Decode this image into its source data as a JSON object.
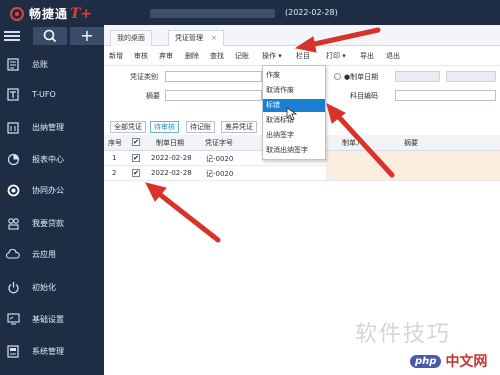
{
  "app": {
    "logo_text": "畅捷通",
    "logo_suffix": "T+",
    "date": "(2022-02-28)"
  },
  "sidebar": {
    "items": [
      {
        "label": "总账",
        "icon": "ledger-icon"
      },
      {
        "label": "T-UFO",
        "icon": "report-t-icon"
      },
      {
        "label": "出纳管理",
        "icon": "cashier-icon"
      },
      {
        "label": "报表中心",
        "icon": "pie-chart-icon"
      },
      {
        "label": "协同办公",
        "icon": "collab-icon"
      },
      {
        "label": "我要贷款",
        "icon": "loan-icon"
      },
      {
        "label": "云应用",
        "icon": "cloud-icon"
      },
      {
        "label": "初始化",
        "icon": "power-icon"
      },
      {
        "label": "基础设置",
        "icon": "settings-icon"
      },
      {
        "label": "系统管理",
        "icon": "system-icon"
      }
    ]
  },
  "tabs": {
    "desktop": "我的桌面",
    "voucher": "凭证管理",
    "close": "×"
  },
  "toolbar": {
    "new": "新增",
    "audit": "审核",
    "cancel_audit": "弃审",
    "delete": "删除",
    "find": "查找",
    "post": "记账",
    "operate": "操作 ▾",
    "columns": "栏目",
    "print": "打印 ▾",
    "export": "导出",
    "exit": "退出"
  },
  "form": {
    "voucher_type_label": "凭证类别",
    "summary_label": "摘要",
    "date_label": "●制单日期",
    "account_label": "科目编码"
  },
  "filter_tabs": {
    "all": "全部凭证",
    "to_audit": "待审核",
    "to_post": "待记账",
    "error": "差异凭证"
  },
  "table": {
    "headers": {
      "seq": "序号",
      "check": "✔",
      "date": "制单日期",
      "voucher_no": "凭证字号",
      "maker": "制单人",
      "summary": "摘要"
    },
    "rows": [
      {
        "seq": "1",
        "check": "✔",
        "date": "2022-02-28",
        "voucher_no": "记-0020"
      },
      {
        "seq": "2",
        "check": "✔",
        "date": "2022-02-28",
        "voucher_no": "记-0020"
      }
    ]
  },
  "dropdown": {
    "items": [
      "作废",
      "取消作废",
      "标错",
      "取消标错",
      "出纳签字",
      "取消出纳签字"
    ],
    "highlighted_index": 2
  },
  "watermark": {
    "cn": "软件技巧",
    "php_badge": "php",
    "php_text": "中文网"
  },
  "colors": {
    "sidebar_bg": "#1e2d44",
    "highlight": "#1a7fd1",
    "arrow": "#d9322c"
  }
}
